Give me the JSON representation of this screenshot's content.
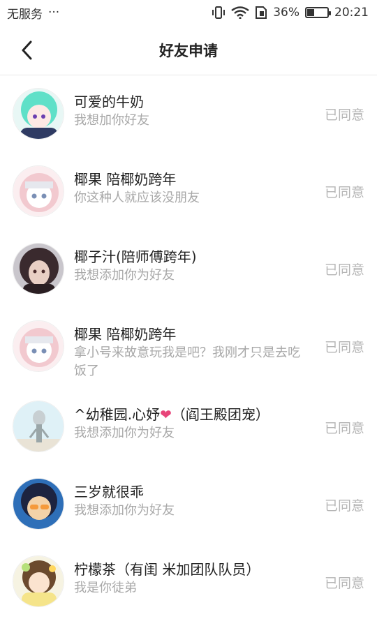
{
  "status_bar": {
    "carrier": "无服务",
    "dots": "···",
    "battery_percent": "36%",
    "battery_level": 0.36,
    "time": "20:21"
  },
  "header": {
    "title": "好友申请",
    "back_icon": "chevron-left-icon"
  },
  "requests": [
    {
      "name": "可爱的牛奶",
      "message": "我想加你好友",
      "status": "已同意",
      "avatar_colors": [
        "#5fe0c8",
        "#2f3b63"
      ]
    },
    {
      "name": "椰果  陪椰奶跨年",
      "message": "你这种人就应该没朋友",
      "status": "已同意",
      "avatar_colors": [
        "#f2c9cf",
        "#ffffff"
      ]
    },
    {
      "name": "椰子汁(陪师傅跨年)",
      "message": "我想添加你为好友",
      "status": "已同意",
      "avatar_colors": [
        "#3a2a2e",
        "#c98f8a"
      ]
    },
    {
      "name": "椰果  陪椰奶跨年",
      "message": "拿小号来故意玩我是吧？我刚才只是去吃饭了",
      "status": "已同意",
      "avatar_colors": [
        "#f2c9cf",
        "#ffffff"
      ]
    },
    {
      "name_prefix": "^幼稚园.心妤",
      "heart": "❤",
      "name_suffix": "（阎王殿团宠）",
      "message": "我想添加你为好友",
      "status": "已同意",
      "avatar_colors": [
        "#dff1f7",
        "#9aa6a8"
      ]
    },
    {
      "name": "三岁就很乖",
      "message": "我想添加你为好友",
      "status": "已同意",
      "avatar_colors": [
        "#2e6fb8",
        "#f3d2a8"
      ]
    },
    {
      "name": "柠檬茶（有闺 米加团队队员）",
      "message": "我是你徒弟",
      "status": "已同意",
      "avatar_colors": [
        "#f5e48a",
        "#6b4a2e"
      ]
    }
  ]
}
